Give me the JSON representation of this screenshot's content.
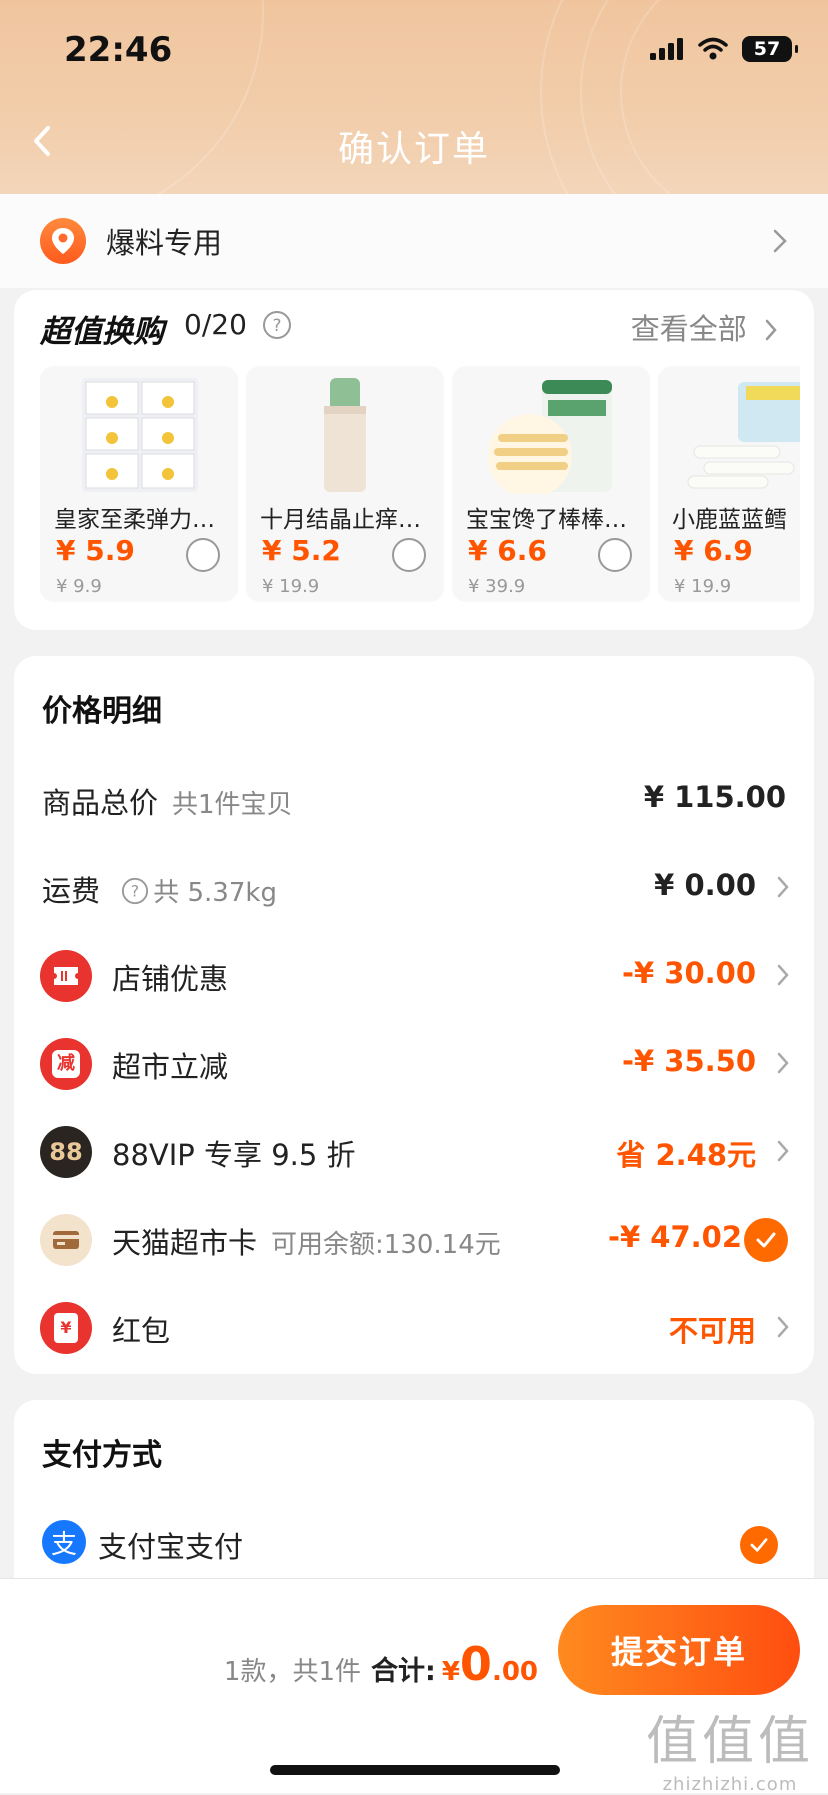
{
  "status_bar": {
    "time": "22:46",
    "battery": "57"
  },
  "nav": {
    "title": "确认订单"
  },
  "address": {
    "label": "爆料专用"
  },
  "exchange": {
    "title": "超值换购",
    "count": "0/20",
    "more": "查看全部",
    "products": [
      {
        "name": "皇家至柔弹力…",
        "price": "¥ 5.9",
        "original": "¥ 9.9"
      },
      {
        "name": "十月结晶止痒…",
        "price": "¥ 5.2",
        "original": "¥ 19.9"
      },
      {
        "name": "宝宝馋了棒棒…",
        "price": "¥ 6.6",
        "original": "¥ 39.9"
      },
      {
        "name": "小鹿蓝蓝鳕",
        "price": "¥ 6.9",
        "original": "¥ 19.9"
      }
    ]
  },
  "prices": {
    "title": "价格明细",
    "rows": [
      {
        "label": "商品总价",
        "sub": "共1件宝贝",
        "value": "¥ 115.00"
      },
      {
        "label": "运费",
        "sub": "共 5.37kg",
        "value": "¥ 0.00"
      },
      {
        "label": "店铺优惠",
        "value": "-¥ 30.00"
      },
      {
        "label": "超市立减",
        "icon_text": "减",
        "value": "-¥ 35.50"
      },
      {
        "label": "88VIP 专享 9.5 折",
        "icon_text": "88",
        "value": "省 2.48元"
      },
      {
        "label": "天猫超市卡",
        "sub": "可用余额:130.14元",
        "value": "-¥ 47.02"
      },
      {
        "label": "红包",
        "icon_text": "¥",
        "value": "不可用"
      }
    ]
  },
  "payment": {
    "title": "支付方式",
    "method": "支付宝支付",
    "icon_text": "支"
  },
  "bottom": {
    "count_text": "1款，共1件",
    "total_label": "合计:",
    "currency": "¥",
    "total_int": "0",
    "total_dec": ".00",
    "submit_label": "提交订单"
  },
  "watermark": {
    "main": "值值值",
    "sub": "zhizhizhi.com"
  },
  "colors": {
    "accent": "#ff5500",
    "header": "#f0c59e"
  }
}
